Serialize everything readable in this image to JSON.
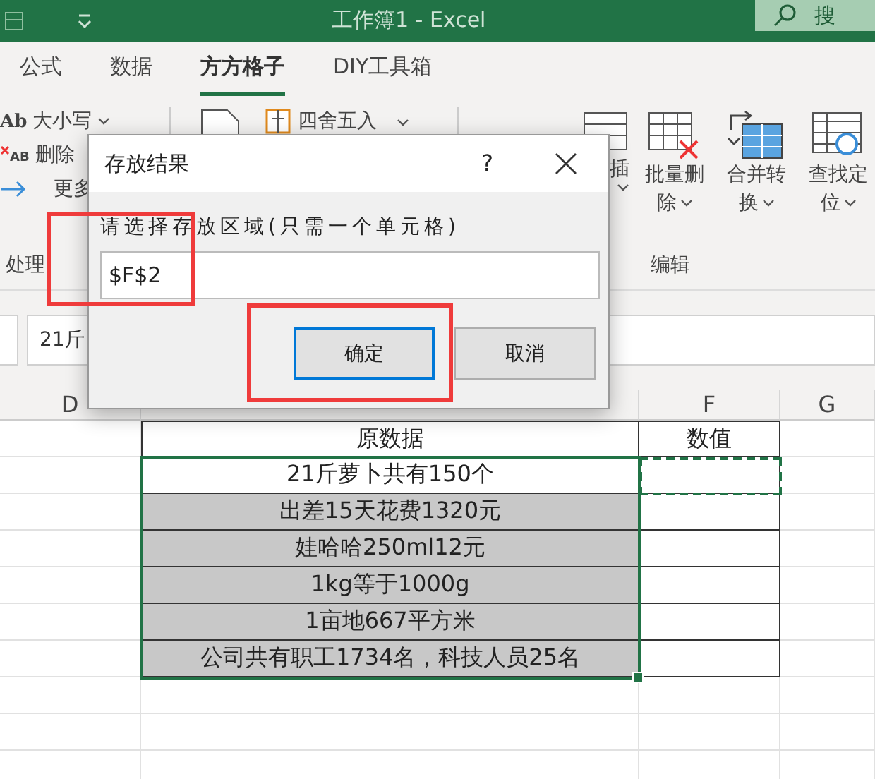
{
  "title_bar": {
    "title": "工作簿1  -  Excel",
    "search_text": "搜"
  },
  "tabs": [
    {
      "label": "公式",
      "selected": false
    },
    {
      "label": "数据",
      "selected": false
    },
    {
      "label": "方方格子",
      "selected": true
    },
    {
      "label": "DIY工具箱",
      "selected": false
    }
  ],
  "ribbon": {
    "small_buttons": [
      {
        "icon_text": "Ab",
        "label": "大小写",
        "dropdown": true
      },
      {
        "icon_text": "AB",
        "label": "删除",
        "dropdown": false
      },
      {
        "label": "更多",
        "dropdown": false
      }
    ],
    "left_group_label": "处理",
    "round_button": {
      "label": "四舍五入",
      "dropdown": true
    },
    "large_buttons": [
      {
        "lines": [
          "插"
        ],
        "dropdown": true
      },
      {
        "lines": [
          "批量删",
          "除"
        ],
        "dropdown": true
      },
      {
        "lines": [
          "合并转",
          "换"
        ],
        "dropdown": true
      },
      {
        "lines": [
          "查找定",
          "位"
        ],
        "dropdown": true
      }
    ],
    "right_group_label": "编辑"
  },
  "formula_bar": {
    "value": "21斤"
  },
  "sheet": {
    "column_letters": [
      "D",
      "F",
      "G"
    ],
    "header": [
      "原数据",
      "数值"
    ],
    "rows": [
      {
        "text": "21斤萝卜共有150个",
        "shaded": false
      },
      {
        "text": "出差15天花费1320元",
        "shaded": true
      },
      {
        "text": "娃哈哈250ml12元",
        "shaded": true
      },
      {
        "text": "1kg等于1000g",
        "shaded": true
      },
      {
        "text": "1亩地667平方米",
        "shaded": true
      },
      {
        "text": "公司共有职工1734名，科技人员25名",
        "shaded": true
      }
    ]
  },
  "dialog": {
    "title": "存放结果",
    "help": "?",
    "prompt": "请选择存放区域(只需一个单元格)",
    "value": "$F$2",
    "buttons": [
      {
        "label": "确定",
        "focused": true
      },
      {
        "label": "取消",
        "focused": false
      }
    ]
  }
}
